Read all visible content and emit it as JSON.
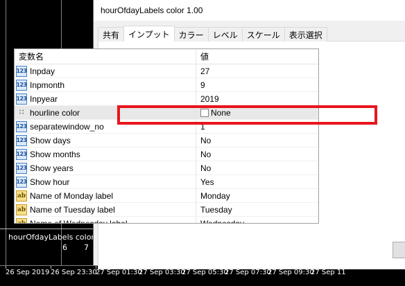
{
  "dialog": {
    "title": "hourOfdayLabels color 1.00",
    "tabs": [
      "共有",
      "インプット",
      "カラー",
      "レベル",
      "スケール",
      "表示選択"
    ],
    "active_tab": "インプット",
    "columns": {
      "name": "変数名",
      "value": "値"
    },
    "params": [
      {
        "icon": "numeric-icon",
        "name": "Inpday",
        "value": "27"
      },
      {
        "icon": "numeric-icon",
        "name": "Inpmonth",
        "value": "9"
      },
      {
        "icon": "numeric-icon",
        "name": "Inpyear",
        "value": "2019"
      },
      {
        "icon": "color-icon",
        "name": "hourline color",
        "value": "None"
      },
      {
        "icon": "numeric-icon",
        "name": "separatewindow_no",
        "value": "1"
      },
      {
        "icon": "numeric-icon",
        "name": "Show days",
        "value": "No"
      },
      {
        "icon": "numeric-icon",
        "name": "Show months",
        "value": "No"
      },
      {
        "icon": "numeric-icon",
        "name": "Show years",
        "value": "No"
      },
      {
        "icon": "numeric-icon",
        "name": "Show hour",
        "value": "Yes"
      },
      {
        "icon": "string-icon",
        "name": "Name of Monday label",
        "value": "Monday"
      },
      {
        "icon": "string-icon",
        "name": "Name of Tuesday label",
        "value": "Tuesday"
      },
      {
        "icon": "string-icon",
        "name": "Name of Wednesday label",
        "value": "Wednesday"
      }
    ],
    "icon_labels": {
      "numeric": "123",
      "string": "ab"
    },
    "highlight_color": "#e8151b"
  },
  "chart": {
    "subwindow_title": "hourOfdayLabels color",
    "subwindow_numbers": [
      "6",
      "7"
    ],
    "time_labels": [
      "26 Sep 2019",
      "26 Sep 23:30",
      "27 Sep 01:30",
      "27 Sep 03:30",
      "27 Sep 05:30",
      "27 Sep 07:30",
      "27 Sep 09:30",
      "27 Sep 11"
    ],
    "candle_color": "#00c000"
  }
}
